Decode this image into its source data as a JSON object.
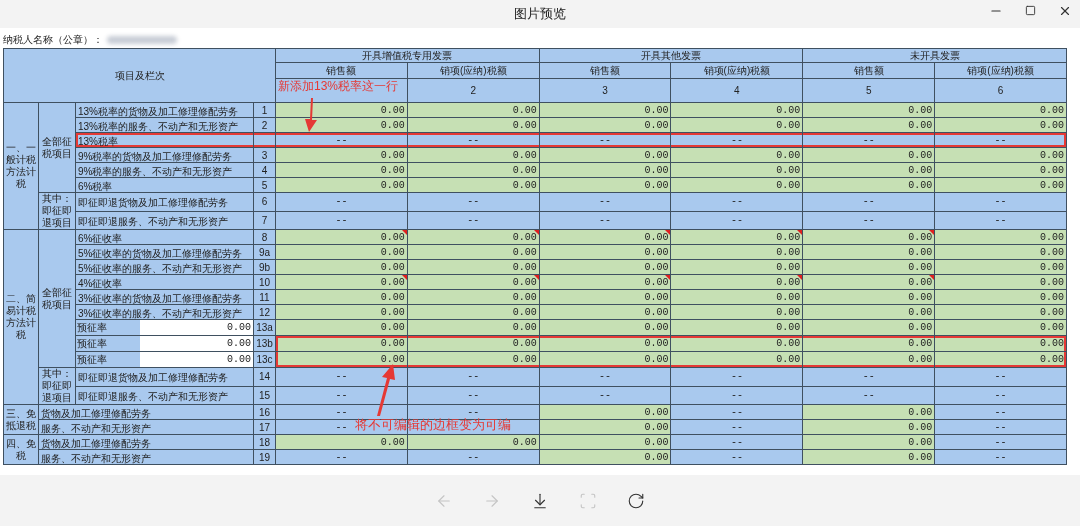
{
  "window": {
    "title": "图片预览"
  },
  "taxpayer": {
    "label": "纳税人名称（公章）："
  },
  "table": {
    "corner": "项目及栏次",
    "columns": [
      {
        "group": "开具增值税专用发票",
        "subs": [
          {
            "label": "销售额"
          },
          {
            "label": "销项(应纳)税额",
            "number": "2"
          }
        ]
      },
      {
        "group": "开具其他发票",
        "subs": [
          {
            "label": "销售额",
            "number": "3"
          },
          {
            "label": "销项(应纳)税额",
            "number": "4"
          }
        ]
      },
      {
        "group": "未开具发票",
        "subs": [
          {
            "label": "销售额",
            "number": "5"
          },
          {
            "label": "销项(应纳)税额",
            "number": "6"
          }
        ]
      }
    ],
    "sections": [
      {
        "title": "一、一般计税方法计税",
        "groups": [
          {
            "title": "全部征税项目",
            "rows": [
              {
                "line": "1",
                "label": "13%税率的货物及加工修理修配劳务",
                "cells": [
                  {
                    "value": "0.00",
                    "editable": true
                  },
                  {
                    "value": "0.00",
                    "editable": true
                  },
                  {
                    "value": "0.00",
                    "editable": true
                  },
                  {
                    "value": "0.00",
                    "editable": true
                  },
                  {
                    "value": "0.00",
                    "editable": true
                  },
                  {
                    "value": "0.00",
                    "editable": true
                  }
                ]
              },
              {
                "line": "2",
                "label": "13%税率的服务、不动产和无形资产",
                "cells": [
                  {
                    "value": "0.00",
                    "editable": true
                  },
                  {
                    "value": "0.00",
                    "editable": true
                  },
                  {
                    "value": "0.00",
                    "editable": true
                  },
                  {
                    "value": "0.00",
                    "editable": true
                  },
                  {
                    "value": "0.00",
                    "editable": true
                  },
                  {
                    "value": "0.00",
                    "editable": true
                  }
                ]
              },
              {
                "label": "13%税率",
                "boxed": true,
                "box_label": true,
                "cells": [
                  {
                    "value": "--",
                    "editable": false
                  },
                  {
                    "value": "--",
                    "editable": false
                  },
                  {
                    "value": "--",
                    "editable": false
                  },
                  {
                    "value": "--",
                    "editable": false
                  },
                  {
                    "value": "--",
                    "editable": false
                  },
                  {
                    "value": "--",
                    "editable": false
                  }
                ]
              },
              {
                "line": "3",
                "label": "9%税率的货物及加工修理修配劳务",
                "cells": [
                  {
                    "value": "0.00",
                    "editable": true
                  },
                  {
                    "value": "0.00",
                    "editable": true
                  },
                  {
                    "value": "0.00",
                    "editable": true
                  },
                  {
                    "value": "0.00",
                    "editable": true
                  },
                  {
                    "value": "0.00",
                    "editable": true
                  },
                  {
                    "value": "0.00",
                    "editable": true
                  }
                ]
              },
              {
                "line": "4",
                "label": "9%税率的服务、不动产和无形资产",
                "cells": [
                  {
                    "value": "0.00",
                    "editable": true
                  },
                  {
                    "value": "0.00",
                    "editable": true
                  },
                  {
                    "value": "0.00",
                    "editable": true
                  },
                  {
                    "value": "0.00",
                    "editable": true
                  },
                  {
                    "value": "0.00",
                    "editable": true
                  },
                  {
                    "value": "0.00",
                    "editable": true
                  }
                ]
              },
              {
                "line": "5",
                "label": "6%税率",
                "cells": [
                  {
                    "value": "0.00",
                    "editable": true
                  },
                  {
                    "value": "0.00",
                    "editable": true
                  },
                  {
                    "value": "0.00",
                    "editable": true
                  },
                  {
                    "value": "0.00",
                    "editable": true
                  },
                  {
                    "value": "0.00",
                    "editable": true
                  },
                  {
                    "value": "0.00",
                    "editable": true
                  }
                ]
              }
            ]
          },
          {
            "title": "其中：即征即退项目",
            "rows": [
              {
                "line": "6",
                "label": "即征即退货物及加工修理修配劳务",
                "cells": [
                  {
                    "value": "--",
                    "editable": false
                  },
                  {
                    "value": "--",
                    "editable": false
                  },
                  {
                    "value": "--",
                    "editable": false
                  },
                  {
                    "value": "--",
                    "editable": false
                  },
                  {
                    "value": "--",
                    "editable": false
                  },
                  {
                    "value": "--",
                    "editable": false
                  }
                ]
              },
              {
                "line": "7",
                "label": "即征即退服务、不动产和无形资产",
                "cells": [
                  {
                    "value": "--",
                    "editable": false
                  },
                  {
                    "value": "--",
                    "editable": false
                  },
                  {
                    "value": "--",
                    "editable": false
                  },
                  {
                    "value": "--",
                    "editable": false
                  },
                  {
                    "value": "--",
                    "editable": false
                  },
                  {
                    "value": "--",
                    "editable": false
                  }
                ]
              }
            ]
          }
        ]
      },
      {
        "title": "二、简易计税方法计税",
        "groups": [
          {
            "title": "全部征税项目",
            "rows": [
              {
                "line": "8",
                "label": "6%征收率",
                "flagged": true,
                "cells": [
                  {
                    "value": "0.00",
                    "editable": true
                  },
                  {
                    "value": "0.00",
                    "editable": true
                  },
                  {
                    "value": "0.00",
                    "editable": true
                  },
                  {
                    "value": "0.00",
                    "editable": true
                  },
                  {
                    "value": "0.00",
                    "editable": true
                  },
                  {
                    "value": "0.00",
                    "editable": true
                  }
                ]
              },
              {
                "line": "9a",
                "label": "5%征收率的货物及加工修理修配劳务",
                "cells": [
                  {
                    "value": "0.00",
                    "editable": true
                  },
                  {
                    "value": "0.00",
                    "editable": true
                  },
                  {
                    "value": "0.00",
                    "editable": true
                  },
                  {
                    "value": "0.00",
                    "editable": true
                  },
                  {
                    "value": "0.00",
                    "editable": true
                  },
                  {
                    "value": "0.00",
                    "editable": true
                  }
                ]
              },
              {
                "line": "9b",
                "label": "5%征收率的服务、不动产和无形资产",
                "cells": [
                  {
                    "value": "0.00",
                    "editable": true
                  },
                  {
                    "value": "0.00",
                    "editable": true
                  },
                  {
                    "value": "0.00",
                    "editable": true
                  },
                  {
                    "value": "0.00",
                    "editable": true
                  },
                  {
                    "value": "0.00",
                    "editable": true
                  },
                  {
                    "value": "0.00",
                    "editable": true
                  }
                ]
              },
              {
                "line": "10",
                "label": "4%征收率",
                "flagged": true,
                "cells": [
                  {
                    "value": "0.00",
                    "editable": true
                  },
                  {
                    "value": "0.00",
                    "editable": true
                  },
                  {
                    "value": "0.00",
                    "editable": true
                  },
                  {
                    "value": "0.00",
                    "editable": true
                  },
                  {
                    "value": "0.00",
                    "editable": true
                  },
                  {
                    "value": "0.00",
                    "editable": true
                  }
                ]
              },
              {
                "line": "11",
                "label": "3%征收率的货物及加工修理修配劳务",
                "cells": [
                  {
                    "value": "0.00",
                    "editable": true
                  },
                  {
                    "value": "0.00",
                    "editable": true
                  },
                  {
                    "value": "0.00",
                    "editable": true
                  },
                  {
                    "value": "0.00",
                    "editable": true
                  },
                  {
                    "value": "0.00",
                    "editable": true
                  },
                  {
                    "value": "0.00",
                    "editable": true
                  }
                ]
              },
              {
                "line": "12",
                "label": "3%征收率的服务、不动产和无形资产",
                "cells": [
                  {
                    "value": "0.00",
                    "editable": true
                  },
                  {
                    "value": "0.00",
                    "editable": true
                  },
                  {
                    "value": "0.00",
                    "editable": true
                  },
                  {
                    "value": "0.00",
                    "editable": true
                  },
                  {
                    "value": "0.00",
                    "editable": true
                  },
                  {
                    "value": "0.00",
                    "editable": true
                  }
                ]
              },
              {
                "line": "13a",
                "label": "预征率",
                "input_value": "0.00",
                "cells": [
                  {
                    "value": "0.00",
                    "editable": true
                  },
                  {
                    "value": "0.00",
                    "editable": true
                  },
                  {
                    "value": "0.00",
                    "editable": true
                  },
                  {
                    "value": "0.00",
                    "editable": true
                  },
                  {
                    "value": "0.00",
                    "editable": true
                  },
                  {
                    "value": "0.00",
                    "editable": true
                  }
                ]
              },
              {
                "line": "13b",
                "label": "预征率",
                "input_value": "0.00",
                "boxed": true,
                "box_label": false,
                "cells": [
                  {
                    "value": "0.00",
                    "editable": true
                  },
                  {
                    "value": "0.00",
                    "editable": true
                  },
                  {
                    "value": "0.00",
                    "editable": true
                  },
                  {
                    "value": "0.00",
                    "editable": true
                  },
                  {
                    "value": "0.00",
                    "editable": true
                  },
                  {
                    "value": "0.00",
                    "editable": true
                  }
                ]
              },
              {
                "line": "13c",
                "label": "预征率",
                "input_value": "0.00",
                "boxed": true,
                "box_label": false,
                "cells": [
                  {
                    "value": "0.00",
                    "editable": true
                  },
                  {
                    "value": "0.00",
                    "editable": true
                  },
                  {
                    "value": "0.00",
                    "editable": true
                  },
                  {
                    "value": "0.00",
                    "editable": true
                  },
                  {
                    "value": "0.00",
                    "editable": true
                  },
                  {
                    "value": "0.00",
                    "editable": true
                  }
                ]
              }
            ]
          },
          {
            "title": "其中：即征即退项目",
            "rows": [
              {
                "line": "14",
                "label": "即征即退货物及加工修理修配劳务",
                "cells": [
                  {
                    "value": "--",
                    "editable": false
                  },
                  {
                    "value": "--",
                    "editable": false
                  },
                  {
                    "value": "--",
                    "editable": false
                  },
                  {
                    "value": "--",
                    "editable": false
                  },
                  {
                    "value": "--",
                    "editable": false
                  },
                  {
                    "value": "--",
                    "editable": false
                  }
                ]
              },
              {
                "line": "15",
                "label": "即征即退服务、不动产和无形资产",
                "cells": [
                  {
                    "value": "--",
                    "editable": false
                  },
                  {
                    "value": "--",
                    "editable": false
                  },
                  {
                    "value": "--",
                    "editable": false
                  },
                  {
                    "value": "--",
                    "editable": false
                  },
                  {
                    "value": "--",
                    "editable": false
                  },
                  {
                    "value": "--",
                    "editable": false
                  }
                ]
              }
            ]
          }
        ]
      },
      {
        "title": "三、免抵退税",
        "rows": [
          {
            "line": "16",
            "label": "货物及加工修理修配劳务",
            "cells": [
              {
                "value": "--",
                "editable": false
              },
              {
                "value": "--",
                "editable": false
              },
              {
                "value": "0.00",
                "editable": true
              },
              {
                "value": "--",
                "editable": false
              },
              {
                "value": "0.00",
                "editable": true
              },
              {
                "value": "--",
                "editable": false
              }
            ]
          },
          {
            "line": "17",
            "label": "服务、不动产和无形资产",
            "cells": [
              {
                "value": "--",
                "editable": false
              },
              {
                "editable": false
              },
              {
                "value": "0.00",
                "editable": true
              },
              {
                "value": "--",
                "editable": false
              },
              {
                "value": "0.00",
                "editable": true
              },
              {
                "value": "--",
                "editable": false
              }
            ]
          }
        ]
      },
      {
        "title": "四、免税",
        "rows": [
          {
            "line": "18",
            "label": "货物及加工修理修配劳务",
            "cells": [
              {
                "value": "0.00",
                "editable": true
              },
              {
                "value": "0.00",
                "editable": true
              },
              {
                "value": "0.00",
                "editable": true
              },
              {
                "value": "--",
                "editable": false
              },
              {
                "value": "0.00",
                "editable": true
              },
              {
                "value": "--",
                "editable": false
              }
            ]
          },
          {
            "line": "19",
            "label": "服务、不动产和无形资产",
            "cells": [
              {
                "value": "--",
                "editable": false
              },
              {
                "value": "--",
                "editable": false
              },
              {
                "value": "0.00",
                "editable": true
              },
              {
                "value": "--",
                "editable": false
              },
              {
                "value": "0.00",
                "editable": true
              },
              {
                "value": "--",
                "editable": false
              }
            ]
          }
        ]
      }
    ]
  },
  "annotations": [
    {
      "text": "新添加13%税率这一行"
    },
    {
      "text": "将不可编辑的边框变为可编"
    }
  ],
  "toolbar": {
    "buttons": [
      {
        "disabled": true
      },
      {
        "disabled": true
      },
      {
        "disabled": false
      },
      {
        "disabled": true
      },
      {
        "disabled": false
      }
    ]
  }
}
